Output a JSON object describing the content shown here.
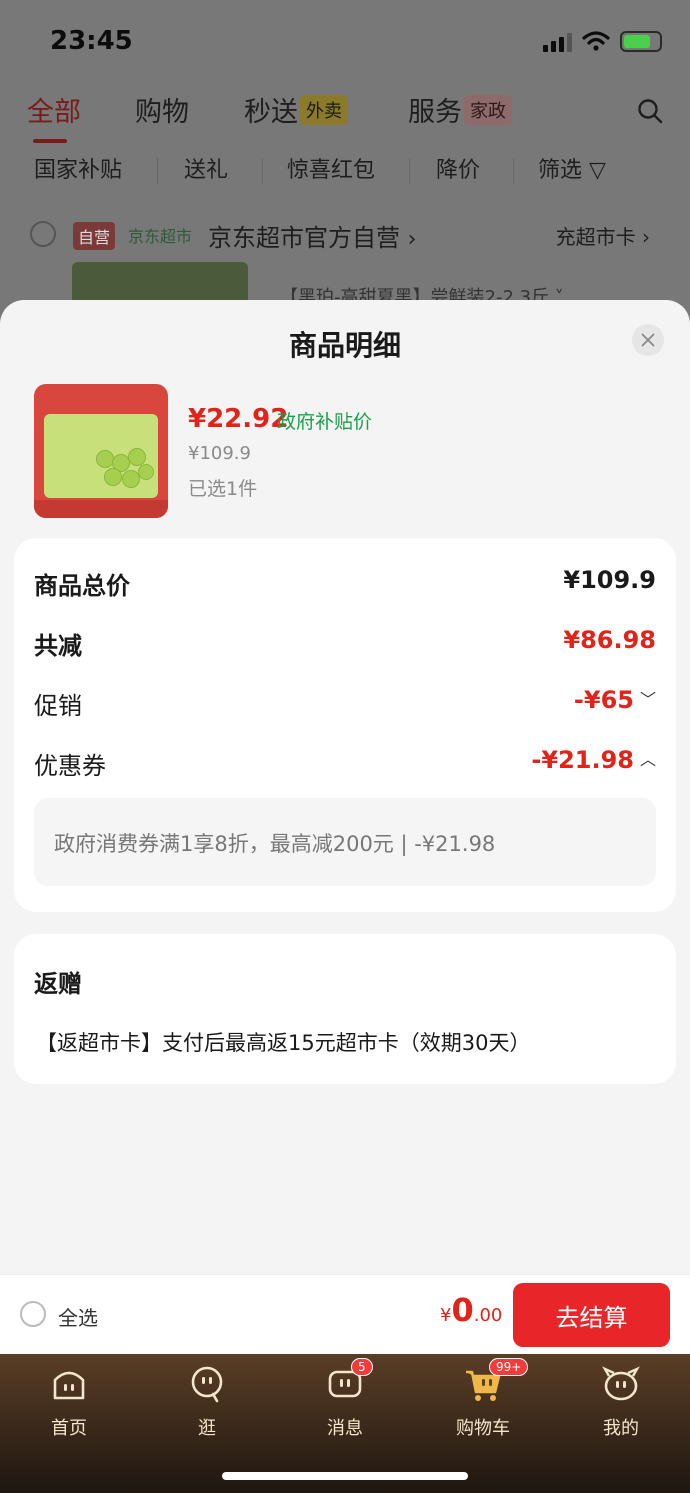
{
  "status_bar": {
    "time": "23:45"
  },
  "top_tabs": [
    {
      "label": "全部"
    },
    {
      "label": "购物"
    },
    {
      "label": "秒送",
      "pill": "外卖"
    },
    {
      "label": "服务",
      "pill": "家政"
    }
  ],
  "filters": [
    "国家补贴",
    "送礼",
    "惊喜红包",
    "降价",
    "筛选"
  ],
  "shop": {
    "tag_self": "自营",
    "tag_market": "京东超市",
    "name": "京东超市官方自营",
    "name_chevron": "›",
    "card_link": "充超市卡 ›"
  },
  "background_product_title": "【黑珀-高甜夏黑】尝鲜装2-2.3斤 ˅",
  "sheet": {
    "title": "商品明细",
    "product": {
      "price_now": "¥22.92",
      "price_tag": "政府补贴价",
      "price_original": "¥109.9",
      "selected_count": "已选1件"
    },
    "summary": {
      "total_label": "商品总价",
      "total_value": "¥109.9",
      "reduction_label": "共减",
      "reduction_value": "¥86.98",
      "promo_label": "促销",
      "promo_value": "-¥65",
      "coupon_label": "优惠券",
      "coupon_value": "-¥21.98",
      "coupon_detail": "政府消费券满1享8折，最高减200元 | -¥21.98"
    },
    "rebate": {
      "title": "返赠",
      "detail": "【返超市卡】支付后最高返15元超市卡（效期30天）"
    }
  },
  "action_bar": {
    "select_all": "全选",
    "total_currency": "¥",
    "total_int": "0",
    "total_dec": ".00",
    "checkout": "去结算"
  },
  "bottom_nav": [
    {
      "label": "首页",
      "icon": "home-face-icon"
    },
    {
      "label": "逛",
      "icon": "browse-face-icon"
    },
    {
      "label": "消息",
      "icon": "message-icon",
      "badge": "5"
    },
    {
      "label": "购物车",
      "icon": "cart-icon",
      "badge": "99+"
    },
    {
      "label": "我的",
      "icon": "profile-icon"
    }
  ],
  "colors": {
    "accent_red": "#e2231a",
    "subsidy_green": "#1ba049",
    "nav_brown": "#5a3e26"
  }
}
